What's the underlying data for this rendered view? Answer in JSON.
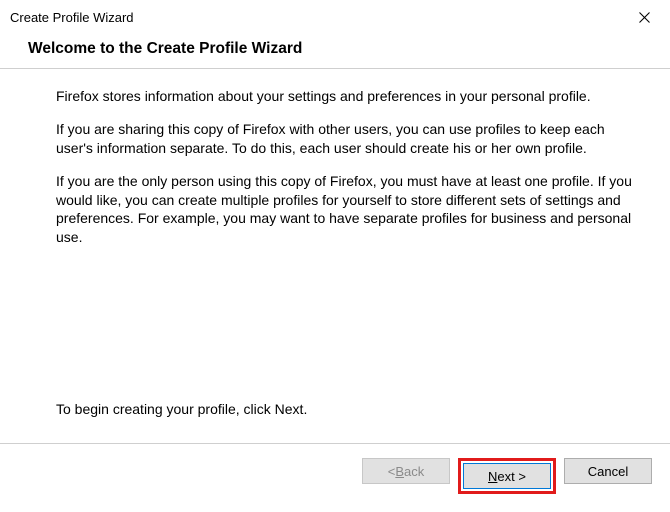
{
  "window": {
    "title": "Create Profile Wizard"
  },
  "heading": "Welcome to the Create Profile Wizard",
  "paragraphs": {
    "p1": "Firefox stores information about your settings and preferences in your personal profile.",
    "p2": "If you are sharing this copy of Firefox with other users, you can use profiles to keep each user's information separate. To do this, each user should create his or her own profile.",
    "p3": "If you are the only person using this copy of Firefox, you must have at least one profile. If you would like, you can create multiple profiles for yourself to store different sets of settings and preferences. For example, you may want to have separate profiles for business and personal use.",
    "begin": "To begin creating your profile, click Next."
  },
  "buttons": {
    "back_prefix": "< ",
    "back_ak": "B",
    "back_rest": "ack",
    "next_ak": "N",
    "next_rest": "ext >",
    "cancel": "Cancel"
  }
}
